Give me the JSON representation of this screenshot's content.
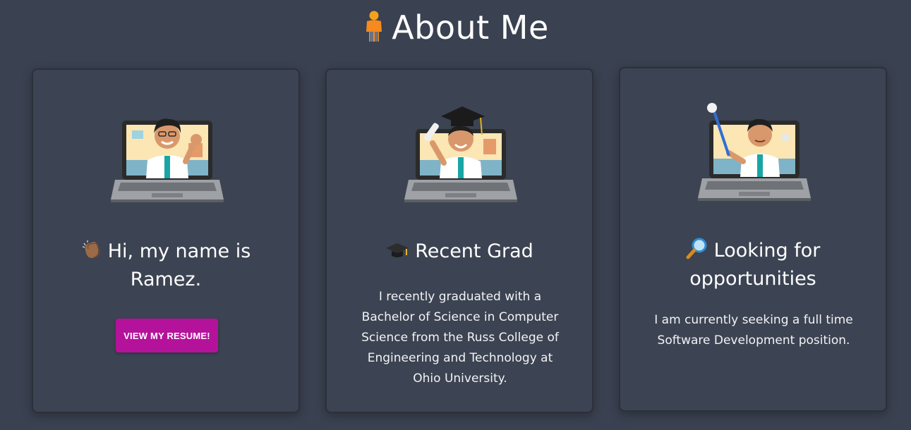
{
  "page": {
    "title": "About Me",
    "title_icon": "person-emoji-icon"
  },
  "cards": [
    {
      "heading_emoji": "clapping-hands-icon",
      "heading": "Hi, my name is Ramez.",
      "image": "bitmoji-waving-laptop",
      "button_label": "VIEW MY RESUME!"
    },
    {
      "heading_emoji": "graduation-cap-icon",
      "heading": "Recent Grad",
      "image": "bitmoji-graduate-laptop",
      "text": "I recently graduated with a Bachelor of Science in Computer Science from the Russ College of Engineering and Technology at Ohio University."
    },
    {
      "heading_emoji": "magnifying-glass-icon",
      "heading": "Looking for opportunities",
      "image": "bitmoji-pointer-laptop",
      "text": "I am currently seeking a full time Software Development position."
    }
  ],
  "colors": {
    "background": "#3a4150",
    "card": "#3c4352",
    "card_border": "#2b303b",
    "button": "#b5129b",
    "text": "#ffffff"
  }
}
